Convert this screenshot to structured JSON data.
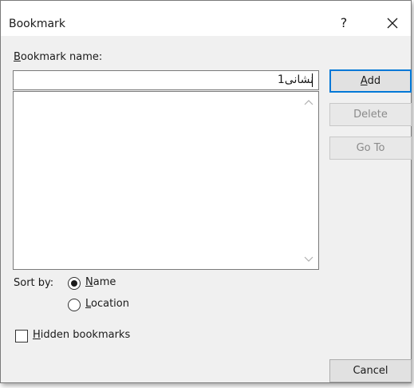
{
  "window": {
    "title": "Bookmark",
    "help_label": "?",
    "close_icon": "close-icon"
  },
  "bookmark_name": {
    "label_accel": "B",
    "label_rest": "ookmark name:",
    "value": "نشانی1"
  },
  "bookmark_list": {
    "items": []
  },
  "buttons": {
    "add_accel": "A",
    "add_rest": "dd",
    "delete_label": "Delete",
    "goto_label": "Go To",
    "cancel_label": "Cancel"
  },
  "sort": {
    "label": "Sort by:",
    "name_accel": "N",
    "name_rest": "ame",
    "location_accel": "L",
    "location_rest": "ocation",
    "selected": "Name"
  },
  "hidden_bookmarks": {
    "accel": "H",
    "rest": "idden bookmarks",
    "checked": false
  },
  "colors": {
    "dialog_bg": "#f0f0f0",
    "default_button_border": "#0078d7",
    "disabled_text": "#8a8a8a"
  }
}
